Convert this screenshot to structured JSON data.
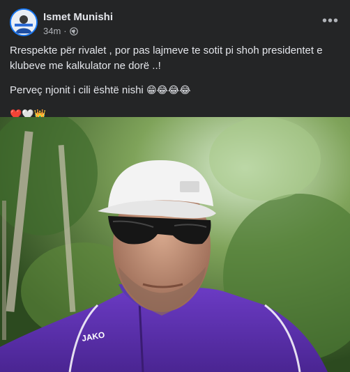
{
  "post": {
    "author": "Ismet Munishi",
    "time": "34m",
    "separator": "·",
    "privacy_icon": "globe-icon",
    "more_icon": "more-icon",
    "more_label": "•••",
    "line1": "Rrespekte për rivalet , por pas lajmeve te sotit pi shoh presidentet e klubeve me kalkulator ne dorë ..!",
    "line2": "Perveç njonit i cili është nishi",
    "line2_emojis": "😁😂😂😂",
    "line3_emojis": "❤️🤍👑",
    "photo_icon": "selfie-photo",
    "jacket_brand": "JAKO"
  },
  "colors": {
    "background": "#242526",
    "text": "#e4e6eb",
    "secondary_text": "#b0b3b8",
    "jacket": "#5b2fa8"
  }
}
